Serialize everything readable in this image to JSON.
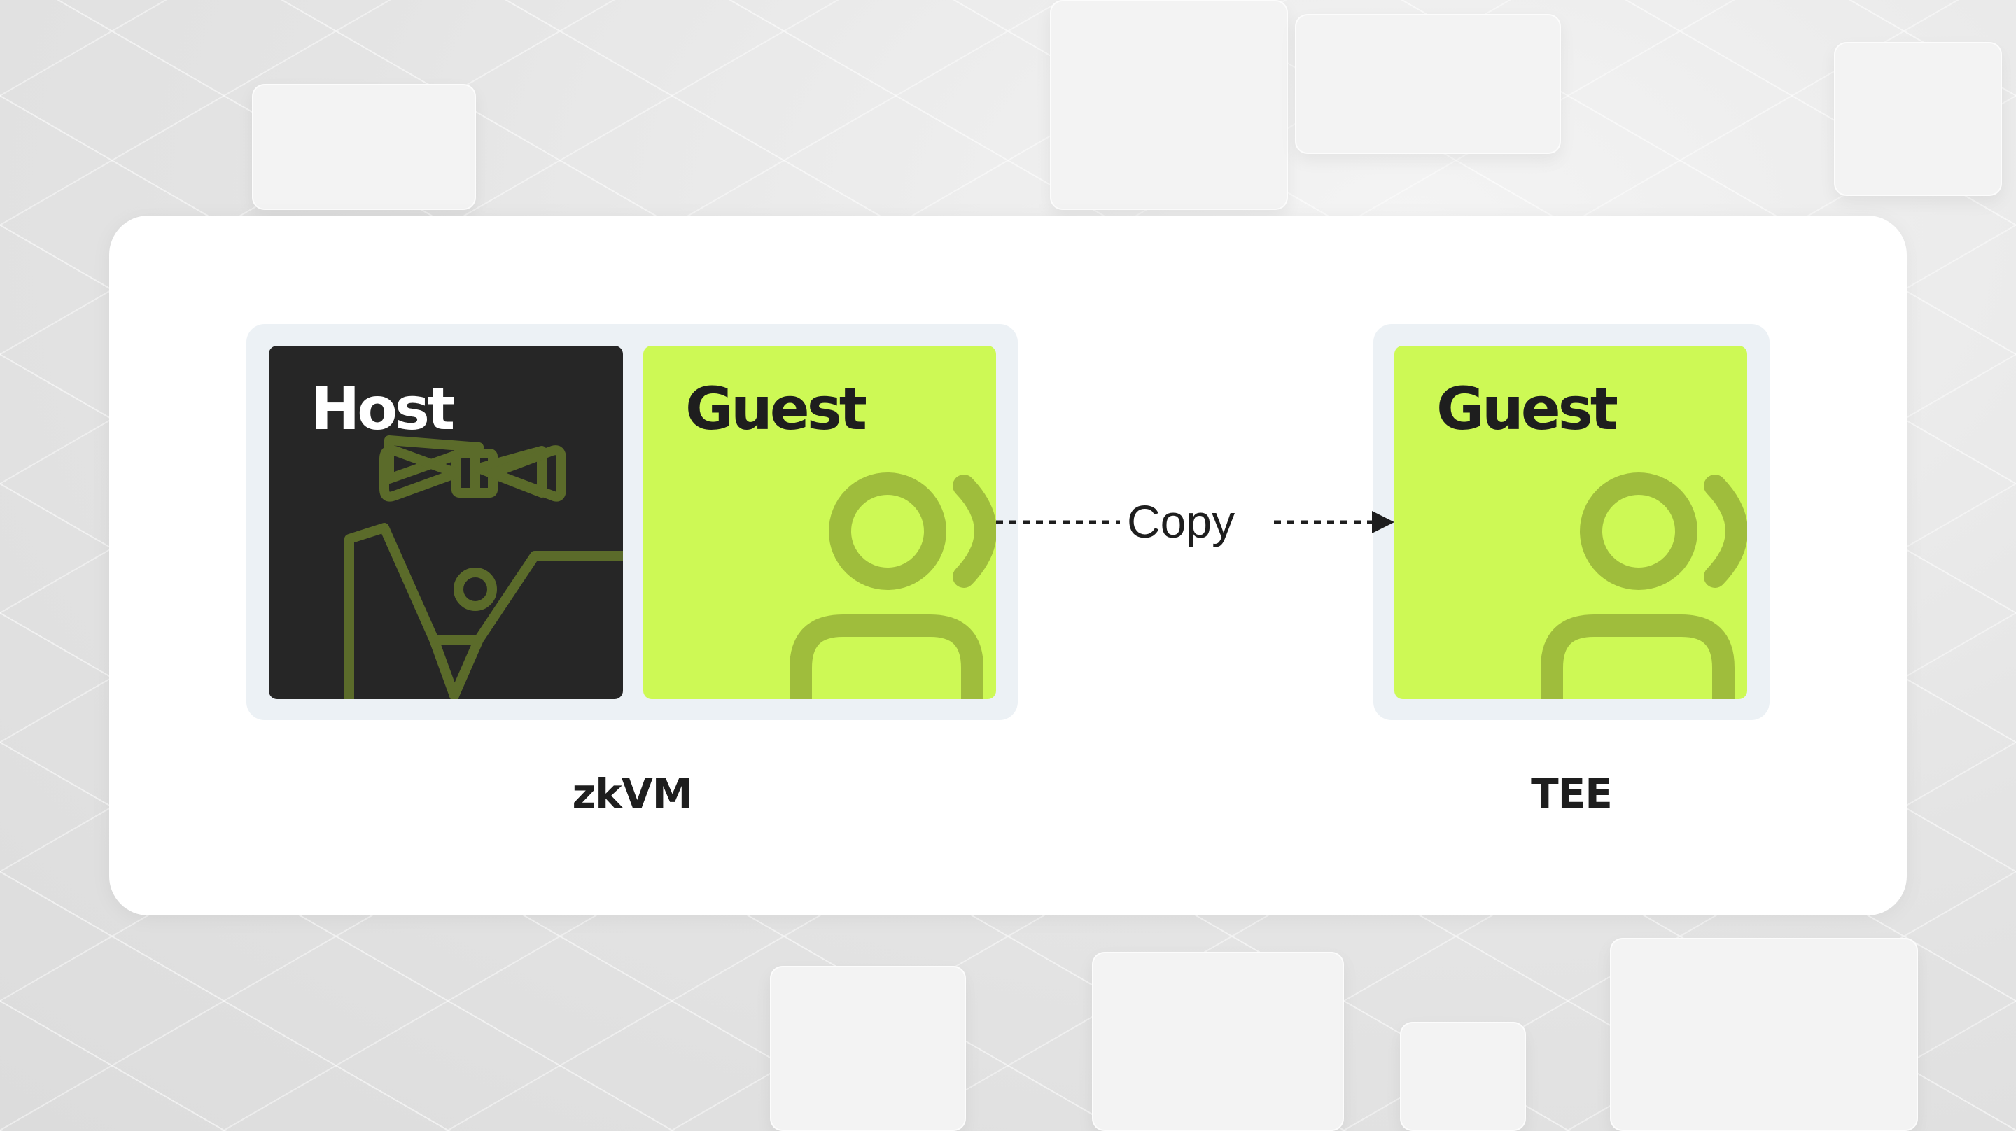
{
  "diagram": {
    "left_group": {
      "caption": "zkVM",
      "host_label": "Host",
      "guest_label": "Guest"
    },
    "right_group": {
      "caption": "TEE",
      "guest_label": "Guest"
    },
    "connector_label": "Copy",
    "icons": {
      "host": "tuxedo-bowtie-icon",
      "guest": "person-icon"
    }
  },
  "colors": {
    "host_bg": "#262626",
    "guest_bg": "#cdf955",
    "host_icon": "#5b6b2a",
    "guest_icon": "#9fbd3c",
    "frame": "#ecf1f5",
    "card": "#ffffff"
  }
}
